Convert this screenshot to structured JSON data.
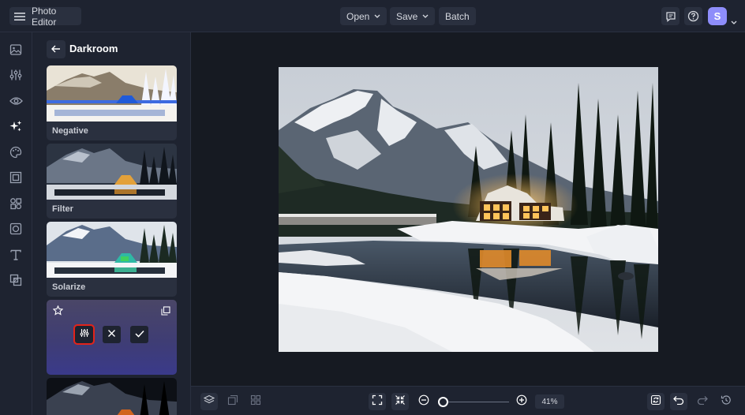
{
  "app": {
    "title": "Photo Editor"
  },
  "toolbar": {
    "open_label": "Open",
    "save_label": "Save",
    "batch_label": "Batch"
  },
  "user": {
    "initial": "S"
  },
  "panel": {
    "title": "Darkroom",
    "effects": [
      {
        "label": "Negative"
      },
      {
        "label": "Filter"
      },
      {
        "label": "Solarize"
      }
    ]
  },
  "zoom": {
    "percent": "41%",
    "level": 0.41
  },
  "icons": {
    "menu": "hamburger-icon",
    "chat": "chat-icon",
    "help": "help-icon",
    "back": "arrow-left-icon",
    "favorite": "star-icon",
    "duplicate": "copy-icon",
    "adjust": "sliders-icon",
    "cancel": "close-icon",
    "apply": "check-icon"
  },
  "colors": {
    "accent": "#8e8dfa",
    "highlight": "#e2231a",
    "background": "#1e2330",
    "canvas": "#161a22"
  }
}
